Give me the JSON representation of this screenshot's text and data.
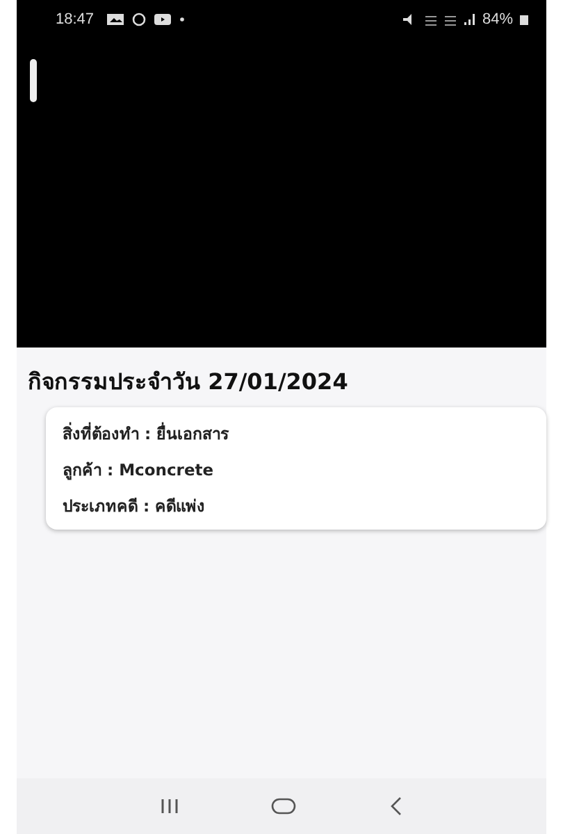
{
  "status_bar": {
    "time": "18:47",
    "battery": "84%"
  },
  "heading": "กิจกรรมประจำวัน 27/01/2024",
  "card": {
    "rows": [
      {
        "label": "สิ่งที่ต้องทำ : ยื่นเอกสาร"
      },
      {
        "label": "ลูกค้า : Mconcrete"
      },
      {
        "label": "ประเภทคดี : คดีแพ่ง"
      }
    ]
  }
}
